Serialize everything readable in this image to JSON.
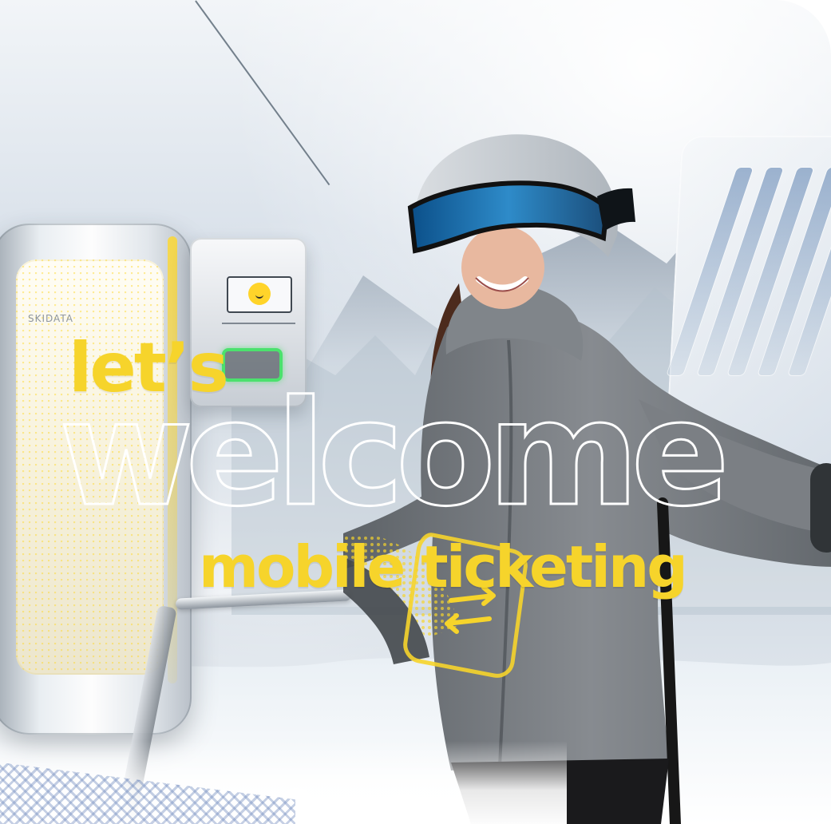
{
  "headline": {
    "line1": "let’s",
    "line2": "welcome",
    "line3": "mobile ticketing"
  },
  "colors": {
    "accent_yellow": "#f6d42b",
    "outline_white": "#ffffff",
    "helmet_gray": "#c9ced3",
    "jacket_gray": "#7a7e82",
    "goggle_blue": "#2e8bc9"
  },
  "icons": {
    "gate_logo": "skidata-logo",
    "reader_smile": "smiley-face-icon",
    "transfer_arrows": "transfer-arrows-icon"
  },
  "branding": {
    "gate_logo_text": "SKIDATA"
  }
}
